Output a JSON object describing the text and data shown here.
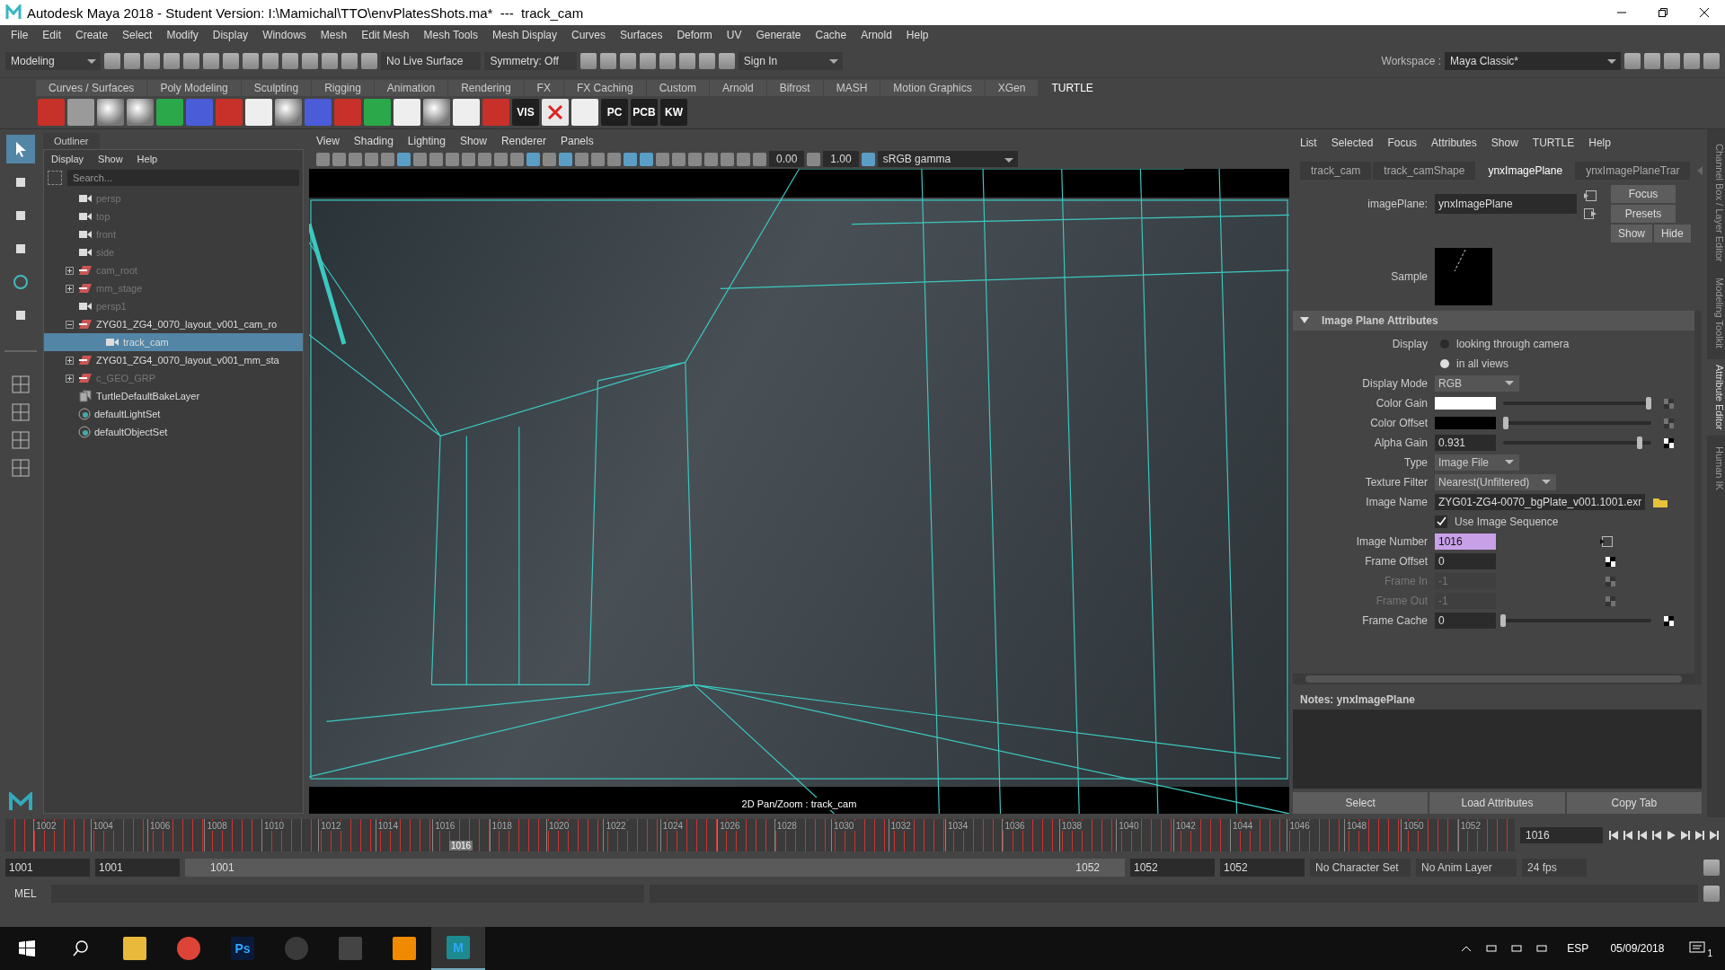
{
  "window": {
    "title": "Autodesk Maya 2018 - Student Version: I:\\Mamichal\\TTO\\envPlatesShots.ma*  ---  track_cam"
  },
  "menu_bar": [
    "File",
    "Edit",
    "Create",
    "Select",
    "Modify",
    "Display",
    "Windows",
    "Mesh",
    "Edit Mesh",
    "Mesh Tools",
    "Mesh Display",
    "Curves",
    "Surfaces",
    "Deform",
    "UV",
    "Generate",
    "Cache",
    "Arnold",
    "Help"
  ],
  "status_line": {
    "menu_set": "Modeling",
    "live_surface": "No Live Surface",
    "symmetry": "Symmetry: Off",
    "sign_in": "Sign In",
    "workspace_label": "Workspace :",
    "workspace": "Maya Classic*"
  },
  "shelf_tabs": [
    {
      "label": "Curves / Surfaces",
      "selected": false
    },
    {
      "label": "Poly Modeling",
      "selected": false
    },
    {
      "label": "Sculpting",
      "selected": false
    },
    {
      "label": "Rigging",
      "selected": false
    },
    {
      "label": "Animation",
      "selected": false
    },
    {
      "label": "Rendering",
      "selected": false
    },
    {
      "label": "FX",
      "selected": false
    },
    {
      "label": "FX Caching",
      "selected": false
    },
    {
      "label": "Custom",
      "selected": false
    },
    {
      "label": "Arnold",
      "selected": false
    },
    {
      "label": "Bifrost",
      "selected": false
    },
    {
      "label": "MASH",
      "selected": false
    },
    {
      "label": "Motion Graphics",
      "selected": false
    },
    {
      "label": "XGen",
      "selected": false
    },
    {
      "label": "TURTLE",
      "selected": true
    }
  ],
  "shelf_icons": [
    {
      "kind": "red"
    },
    {
      "kind": "cube"
    },
    {
      "kind": "sphere"
    },
    {
      "kind": "sphere"
    },
    {
      "kind": "green"
    },
    {
      "kind": "blue"
    },
    {
      "kind": "red"
    },
    {
      "kind": "white"
    },
    {
      "kind": "sphere"
    },
    {
      "kind": "blue"
    },
    {
      "kind": "red"
    },
    {
      "kind": "green"
    },
    {
      "kind": "white"
    },
    {
      "kind": "sphere"
    },
    {
      "kind": "white"
    },
    {
      "kind": "red"
    },
    {
      "kind": "text",
      "label": "VIS"
    },
    {
      "kind": "cross"
    },
    {
      "kind": "white"
    },
    {
      "kind": "text",
      "label": "PC"
    },
    {
      "kind": "text",
      "label": "PCB"
    },
    {
      "kind": "text",
      "label": "KW"
    }
  ],
  "outliner": {
    "title": "Outliner",
    "menus": [
      "Display",
      "Show",
      "Help"
    ],
    "search": {
      "placeholder": "Search..."
    },
    "items": [
      {
        "name": "persp",
        "kind": "camera",
        "dimmed": true,
        "selected": false
      },
      {
        "name": "top",
        "kind": "camera",
        "dimmed": true,
        "selected": false
      },
      {
        "name": "front",
        "kind": "camera",
        "dimmed": true,
        "selected": false
      },
      {
        "name": "side",
        "kind": "camera",
        "dimmed": true,
        "selected": false
      },
      {
        "name": "cam_root",
        "kind": "group",
        "dimmed": true,
        "expanded": false,
        "selected": false
      },
      {
        "name": "mm_stage",
        "kind": "group",
        "dimmed": true,
        "expanded": false,
        "selected": false
      },
      {
        "name": "persp1",
        "kind": "camera",
        "dimmed": true,
        "selected": false
      },
      {
        "name": "ZYG01_ZG4_0070_layout_v001_cam_ro",
        "kind": "group",
        "dimmed": false,
        "expanded": true,
        "selected": false,
        "children": [
          {
            "name": "track_cam",
            "kind": "camera",
            "dimmed": false,
            "selected": true
          }
        ]
      },
      {
        "name": "ZYG01_ZG4_0070_layout_v001_mm_sta",
        "kind": "group",
        "dimmed": false,
        "expanded": false,
        "selected": false
      },
      {
        "name": "c_GEO_GRP",
        "kind": "group",
        "dimmed": true,
        "expanded": false,
        "selected": false
      },
      {
        "name": "TurtleDefaultBakeLayer",
        "kind": "layer",
        "dimmed": false,
        "selected": false
      },
      {
        "name": "defaultLightSet",
        "kind": "set",
        "dimmed": false,
        "selected": false
      },
      {
        "name": "defaultObjectSet",
        "kind": "set",
        "dimmed": false,
        "selected": false
      }
    ]
  },
  "viewport": {
    "menus": [
      "View",
      "Shading",
      "Lighting",
      "Show",
      "Renderer",
      "Panels"
    ],
    "exposure": "0.00",
    "gamma": "1.00",
    "color_space": "sRGB gamma",
    "hud": "2D Pan/Zoom : track_cam"
  },
  "attribute_editor": {
    "menus": [
      "List",
      "Selected",
      "Focus",
      "Attributes",
      "Show",
      "TURTLE",
      "Help"
    ],
    "tabs": [
      {
        "label": "track_cam",
        "selected": false
      },
      {
        "label": "track_camShape",
        "selected": false
      },
      {
        "label": "ynxImagePlane",
        "selected": true
      },
      {
        "label": "ynxImagePlaneTrar",
        "selected": false
      }
    ],
    "node_label": "imagePlane:",
    "node_name": "ynxImagePlane",
    "buttons": [
      "Focus",
      "Presets",
      "Show",
      "Hide"
    ],
    "sample_label": "Sample",
    "section": {
      "title": "Image Plane Attributes",
      "expanded": true
    },
    "attributes": [
      {
        "kind": "radio",
        "label": "Display",
        "options": [
          {
            "label": "looking through camera",
            "selected": false
          },
          {
            "label": "in all views",
            "selected": true
          }
        ]
      },
      {
        "kind": "dropdown",
        "label": "Display Mode",
        "value": "RGB"
      },
      {
        "kind": "color",
        "label": "Color Gain",
        "color": "#ffffff",
        "level": 0.98
      },
      {
        "kind": "color",
        "label": "Color Offset",
        "color": "#000000",
        "level": 0.02
      },
      {
        "kind": "slider",
        "label": "Alpha Gain",
        "value": "0.931",
        "level": 0.92
      },
      {
        "kind": "dropdown",
        "label": "Type",
        "value": "Image File"
      },
      {
        "kind": "dropdown",
        "label": "Texture Filter",
        "value": "Nearest(Unfiltered)"
      },
      {
        "kind": "file",
        "label": "Image Name",
        "value": "ZYG01-ZG4-0070_bgPlate_v001.1001.exr"
      },
      {
        "kind": "checkbox",
        "label": "Use Image Sequence",
        "checked": true
      },
      {
        "kind": "field",
        "label": "Image Number",
        "value": "1016",
        "expression": true,
        "disabled": false
      },
      {
        "kind": "field",
        "label": "Frame Offset",
        "value": "0",
        "expression": false,
        "disabled": false
      },
      {
        "kind": "field",
        "label": "Frame In",
        "value": "-1",
        "expression": false,
        "disabled": true
      },
      {
        "kind": "field",
        "label": "Frame Out",
        "value": "-1",
        "expression": false,
        "disabled": true
      },
      {
        "kind": "slider",
        "label": "Frame Cache",
        "value": "0",
        "level": 0.0
      }
    ],
    "notes_label": "Notes:  ynxImagePlane",
    "bottom_buttons": [
      "Select",
      "Load Attributes",
      "Copy Tab"
    ]
  },
  "side_tabs": [
    {
      "label": "Channel Box / Layer Editor",
      "selected": false
    },
    {
      "label": "Modeling Toolkit",
      "selected": false
    },
    {
      "label": "Attribute Editor",
      "selected": true
    },
    {
      "label": "Human IK",
      "selected": false
    }
  ],
  "time_slider": {
    "ticks": [
      "1002",
      "1004",
      "1006",
      "1008",
      "1010",
      "1012",
      "1014",
      "1016",
      "1018",
      "1020",
      "1022",
      "1024",
      "1026",
      "1028",
      "1030",
      "1032",
      "1034",
      "1036",
      "1038",
      "1040",
      "1042",
      "1044",
      "1046",
      "1048",
      "1050",
      "1052"
    ],
    "current": "1016",
    "level": 0.294,
    "current_field": "1016"
  },
  "range_slider": {
    "start": "1001",
    "playback_start": "1001",
    "range_start": "1001",
    "range_end": "1052",
    "level": 1.0,
    "playback_end": "1052",
    "end": "1052",
    "character_set": "No Character Set",
    "anim_layer": "No Anim Layer",
    "fps": "24 fps"
  },
  "command_line": {
    "language": "MEL"
  },
  "taskbar": {
    "apps": [
      {
        "kind": "folder",
        "selected": false
      },
      {
        "kind": "browser",
        "selected": false
      },
      {
        "kind": "text",
        "label": "Ps",
        "selected": false
      },
      {
        "kind": "obs",
        "selected": false
      },
      {
        "kind": "photos",
        "selected": false
      },
      {
        "kind": "cone",
        "selected": false
      },
      {
        "kind": "maya",
        "label": "M",
        "selected": true
      }
    ],
    "language": "ESP",
    "date": "05/09/2018",
    "notifications": "1"
  }
}
